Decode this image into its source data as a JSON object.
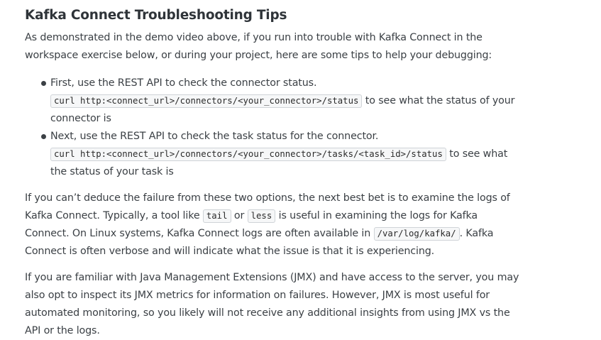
{
  "heading": "Kafka Connect Troubleshooting Tips",
  "intro": "As demonstrated in the demo video above, if you run into trouble with Kafka Connect in the workspace exercise below, or during your project, here are some tips to help your debugging:",
  "tips": [
    {
      "lead": "First, use the REST API to check the connector status.",
      "code": "curl http:<connect_url>/connectors/<your_connector>/status",
      "tail": " to see what the status of your connector is"
    },
    {
      "lead": "Next, use the REST API to check the task status for the connector.",
      "code": "curl http:<connect_url>/connectors/<your_connector>/tasks/<task_id>/status",
      "tail": " to see what the status of your task is"
    }
  ],
  "logs_paragraph": {
    "part1": "If you can’t deduce the failure from these two options, the next best bet is to examine the logs of Kafka Connect. Typically, a tool like ",
    "code_tail": "tail",
    "part2": " or ",
    "code_less": "less",
    "part3": " is useful in examining the logs for Kafka Connect. On Linux systems, Kafka Connect logs are often available in ",
    "code_path": "/var/log/kafka/",
    "part4": ". Kafka Connect is often verbose and will indicate what the issue is that it is experiencing."
  },
  "jmx_paragraph": "If you are familiar with Java Management Extensions (JMX) and have access to the server, you may also opt to inspect its JMX metrics for information on failures. However, JMX is most useful for automated monitoring, so you likely will not receive any additional insights from using JMX vs the API or the logs."
}
